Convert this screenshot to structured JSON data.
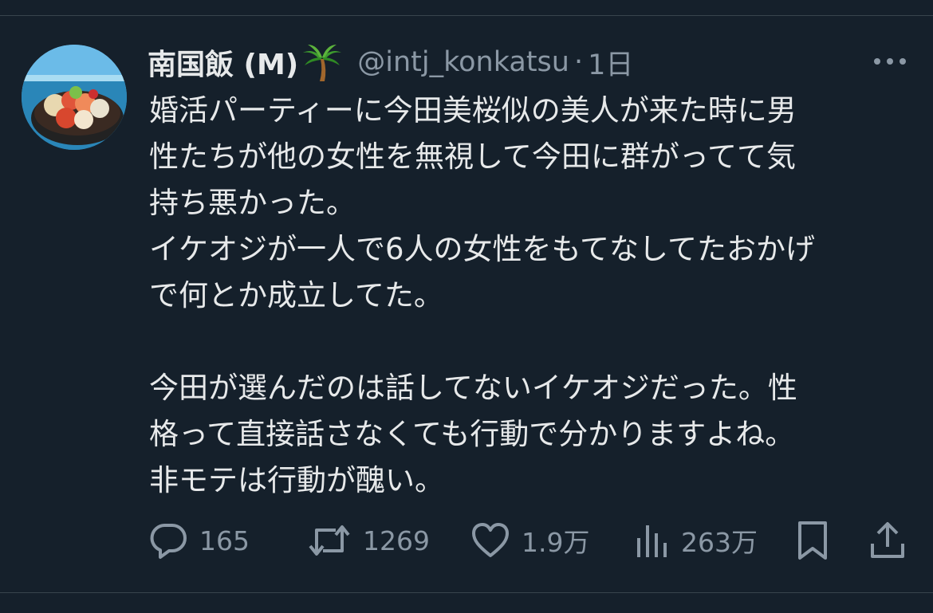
{
  "author": {
    "display_name": "南国飯 (M)",
    "handle": "@intj_konkatsu",
    "separator": "·",
    "time": "1日"
  },
  "tweet": {
    "lines": [
      "婚活パーティーに今田美桜似の美人が来た時に男",
      "性たちが他の女性を無視して今田に群がってて気",
      "持ち悪かった。",
      "イケオジが一人で6人の女性をもてなしてたおかげ",
      "で何とか成立してた。",
      "",
      "今田が選んだのは話してないイケオジだった。性",
      "格って直接話さなくても行動で分かりますよね。",
      "非モテは行動が醜い。"
    ]
  },
  "actions": {
    "reply_count": "165",
    "retweet_count": "1269",
    "like_count": "1.9万",
    "view_count": "263万"
  },
  "icons": {
    "name_emoji": "palm-tree-icon",
    "more": "more-dots-icon",
    "reply": "reply-icon",
    "retweet": "retweet-icon",
    "like": "heart-icon",
    "views": "views-chart-icon",
    "bookmark": "bookmark-icon",
    "share": "share-icon"
  },
  "colors": {
    "background": "#15202b",
    "text": "#e7e9ea",
    "secondary": "#8b98a5",
    "divider": "#38444d"
  }
}
